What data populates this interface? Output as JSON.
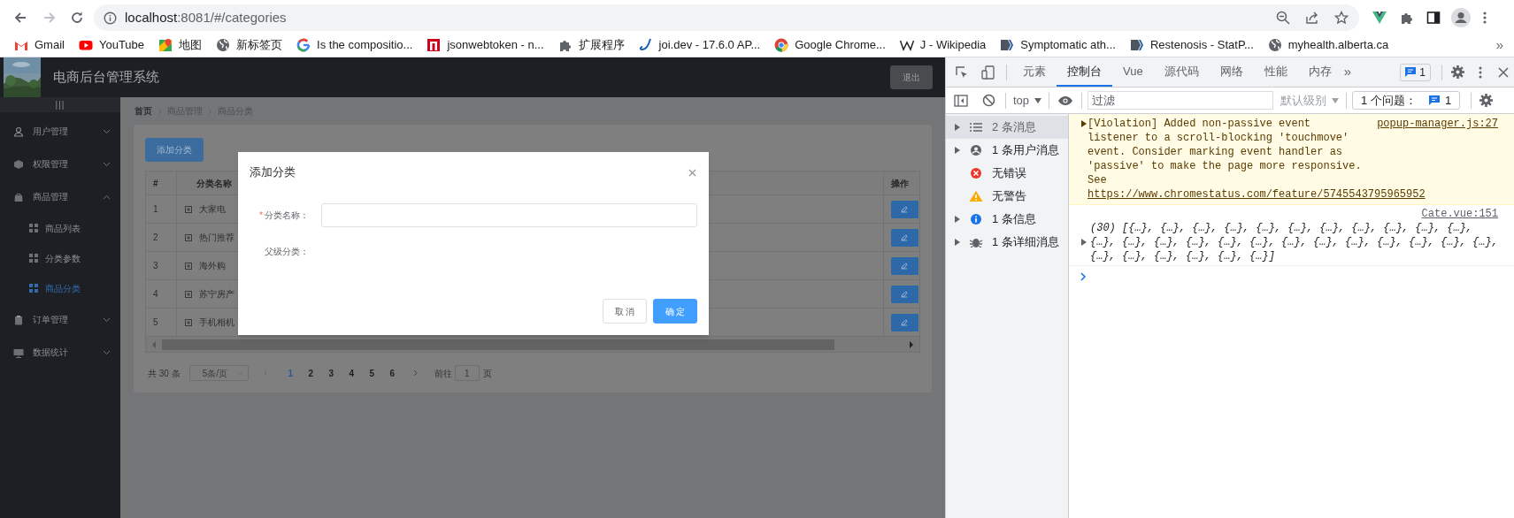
{
  "address_bar": {
    "host": "localhost",
    "path": ":8081/#/categories"
  },
  "bookmarks": [
    {
      "label": "Gmail"
    },
    {
      "label": "YouTube"
    },
    {
      "label": "地图"
    },
    {
      "label": "新标签页"
    },
    {
      "label": "Is the compositio..."
    },
    {
      "label": "jsonwebtoken - n..."
    },
    {
      "label": "扩展程序"
    },
    {
      "label": "joi.dev - 17.6.0 AP..."
    },
    {
      "label": "Google Chrome..."
    },
    {
      "label": "J - Wikipedia"
    },
    {
      "label": "Symptomatic ath..."
    },
    {
      "label": "Restenosis - StatP..."
    },
    {
      "label": "myhealth.alberta.ca"
    }
  ],
  "bookmarks_overflow": "»",
  "app": {
    "title": "电商后台管理系统",
    "logout": "退出",
    "collapse_toggle": "|||"
  },
  "sidebar": {
    "items": [
      {
        "label": "用户管理",
        "kind": "user",
        "expanded": false
      },
      {
        "label": "权限管理",
        "kind": "rights",
        "expanded": false
      },
      {
        "label": "商品管理",
        "kind": "goods",
        "expanded": true,
        "children": [
          {
            "label": "商品列表",
            "selected": false
          },
          {
            "label": "分类参数",
            "selected": false
          },
          {
            "label": "商品分类",
            "selected": true
          }
        ]
      },
      {
        "label": "订单管理",
        "kind": "orders",
        "expanded": false
      },
      {
        "label": "数据统计",
        "kind": "stats",
        "expanded": false
      }
    ]
  },
  "breadcrumb": [
    "首页",
    "商品管理",
    "商品分类"
  ],
  "add_button": "添加分类",
  "table": {
    "columns": [
      "#",
      "分类名称",
      "操作"
    ],
    "rows": [
      {
        "index": "1",
        "name": "大家电"
      },
      {
        "index": "2",
        "name": "热门推荐"
      },
      {
        "index": "3",
        "name": "海外购"
      },
      {
        "index": "4",
        "name": "苏宁房产"
      },
      {
        "index": "5",
        "name": "手机相机"
      }
    ]
  },
  "pagination": {
    "total": "共 30 条",
    "page_size": "5条/页",
    "pages": [
      {
        "label": "1",
        "selected": true
      },
      {
        "label": "2",
        "selected": false
      },
      {
        "label": "3",
        "selected": false
      },
      {
        "label": "4",
        "selected": false
      },
      {
        "label": "5",
        "selected": false
      },
      {
        "label": "6",
        "selected": false
      }
    ],
    "goto_label": "前往",
    "goto_value": "1",
    "goto_suffix": "页"
  },
  "dialog": {
    "title": "添加分类",
    "fields": [
      {
        "label": "分类名称：",
        "required_mark": "*",
        "kind": "input"
      },
      {
        "label": "父级分类：",
        "kind": "empty"
      }
    ],
    "buttons": [
      {
        "label": "取 消",
        "kind": "default"
      },
      {
        "label": "确 定",
        "kind": "primary"
      }
    ]
  },
  "devtools": {
    "tabs": [
      {
        "label": "元素",
        "selected": false
      },
      {
        "label": "控制台",
        "selected": true
      },
      {
        "label": "Vue",
        "selected": false
      },
      {
        "label": "源代码",
        "selected": false
      },
      {
        "label": "网络",
        "selected": false
      },
      {
        "label": "性能",
        "selected": false
      },
      {
        "label": "内存",
        "selected": false
      }
    ],
    "tabs_overflow": "»",
    "issues_badge": "1",
    "toolbar": {
      "context": "top",
      "filter_placeholder": "过滤",
      "level": "默认级别",
      "issues_label": "1 个问题：",
      "issues_count": "1"
    },
    "sidebar": [
      {
        "label": "2 条消息",
        "kind": "all",
        "expandable": true,
        "selected": true
      },
      {
        "label": "1 条用户消息",
        "kind": "user",
        "expandable": true,
        "selected": false
      },
      {
        "label": "无错误",
        "kind": "error",
        "expandable": false,
        "selected": false
      },
      {
        "label": "无警告",
        "kind": "warning",
        "expandable": false,
        "selected": false
      },
      {
        "label": "1 条信息",
        "kind": "info",
        "expandable": true,
        "selected": false
      },
      {
        "label": "1 条详细消息",
        "kind": "verbose",
        "expandable": true,
        "selected": false
      }
    ],
    "messages": [
      {
        "kind": "violation",
        "text": "[Violation] Added non-passive event listener to a scroll-blocking 'touchmove' event. Consider marking event handler as 'passive' to make the page more responsive. See ",
        "link": "https://www.chromestatus.com/feature/5745543795965952",
        "source": "popup-manager.js:27"
      },
      {
        "kind": "log",
        "source": "Cate.vue:151",
        "text": "(30) [{…}, {…}, {…}, {…}, {…}, {…}, {…}, {…}, {…}, {…}, {…}, {…}, {…}, {…}, {…}, {…}, {…}, {…}, {…}, {…}, {…}, {…}, {…}, {…}, {…}, {…}, {…}, {…}, {…}, {…}]"
      }
    ]
  }
}
